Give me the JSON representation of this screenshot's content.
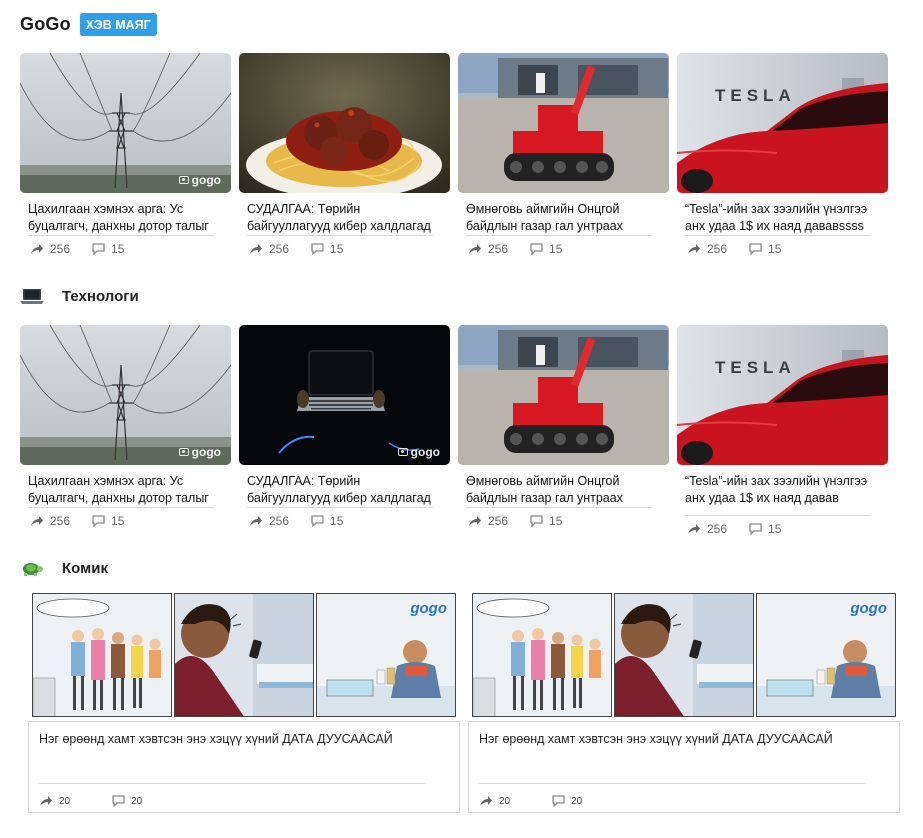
{
  "header": {
    "brand": "GoGo",
    "badge": "ХЭВ МАЯГ"
  },
  "sections": {
    "tech": {
      "title": "Технологи",
      "icon": "laptop-icon"
    },
    "comic": {
      "title": "Комик",
      "icon": "turtle-icon"
    }
  },
  "watermark": "gogo",
  "row1": [
    {
      "title": "Цахилгаан хэмнэх арга: Ус буцалгагч, данхны дотор талыг",
      "shares": "256",
      "comments": "15"
    },
    {
      "title": "СУДАЛГАА: Төрийн байгууллагууд кибер халдлагад",
      "shares": "256",
      "comments": "15"
    },
    {
      "title": "Өмнөговь аймгийн Онцгой байдлын газар гал унтраах",
      "shares": "256",
      "comments": "15"
    },
    {
      "title": "“Tesla”-ийн зах зээлийн үнэлгээ анх удаа 1$ их наяд дававssss",
      "shares": "256",
      "comments": "15"
    }
  ],
  "row2": [
    {
      "title": "Цахилгаан хэмнэх арга: Ус буцалгагч, данхны дотор талыг",
      "shares": "256",
      "comments": "15"
    },
    {
      "title": "СУДАЛГАА: Төрийн байгууллагууд кибер халдлагад",
      "shares": "256",
      "comments": "15"
    },
    {
      "title": "Өмнөговь аймгийн Онцгой байдлын газар гал унтраах",
      "shares": "256",
      "comments": "15"
    },
    {
      "title": "“Tesla”-ийн зах зээлийн үнэлгээ анх удаа 1$ их наяд давав",
      "shares": "256",
      "comments": "15"
    }
  ],
  "comics": [
    {
      "caption": "Нэг өрөөнд хамт хэвтсэн энэ хэцүү хүний ДАТА ДУУСААСАЙ",
      "shares": "20",
      "comments": "20",
      "logo": "gogo"
    },
    {
      "caption": "Нэг өрөөнд хамт хэвтсэн энэ хэцүү хүний ДАТА ДУУСААСАЙ",
      "shares": "20",
      "comments": "20",
      "logo": "gogo"
    }
  ],
  "colors": {
    "accent": "#2fa0e7",
    "tesla_red": "#c8141e",
    "robot_red": "#d61820"
  }
}
